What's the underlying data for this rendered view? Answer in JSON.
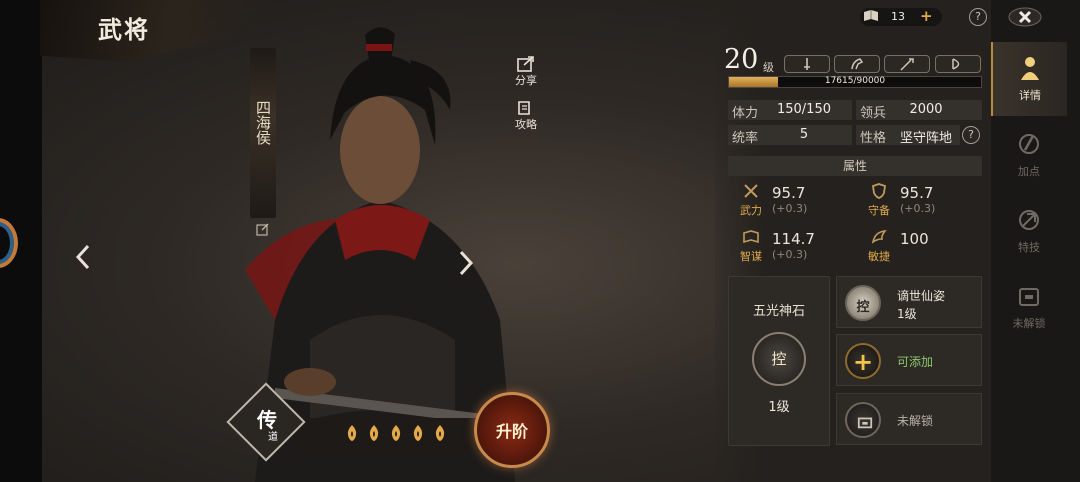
{
  "page_title": "武将",
  "hero": {
    "title_banner": "四海侯",
    "share_label": "分享",
    "guide_label": "攻略"
  },
  "bottom": {
    "chuandao_main": "传",
    "chuandao_sub": "道",
    "star_count": 5,
    "upgrade_label": "升阶"
  },
  "currency": {
    "value": "13",
    "plus": "+"
  },
  "help_glyph": "?",
  "level": {
    "value": "20",
    "unit": "级",
    "exp_text": "17615/90000",
    "exp_fraction": 0.1957
  },
  "stats": {
    "stamina_label": "体力",
    "stamina_value": "150/150",
    "troops_label": "领兵",
    "troops_value": "2000",
    "command_label": "统率",
    "command_value": "5",
    "nature_label": "性格",
    "nature_value": "坚守阵地"
  },
  "attributes": {
    "header": "属性",
    "items": [
      {
        "name": "武力",
        "value": "95.7",
        "bonus": "(+0.3)"
      },
      {
        "name": "守备",
        "value": "95.7",
        "bonus": "(+0.3)"
      },
      {
        "name": "智谋",
        "value": "114.7",
        "bonus": "(+0.3)"
      },
      {
        "name": "敏捷",
        "value": "100",
        "bonus": ""
      }
    ]
  },
  "stone": {
    "title": "五光神石",
    "char": "控",
    "level": "1级"
  },
  "skills": [
    {
      "name": "谪世仙姿",
      "level": "1级",
      "char": "控"
    },
    {
      "status": "可添加"
    },
    {
      "status": "未解锁"
    }
  ],
  "tabs": [
    {
      "label": "详情",
      "active": true
    },
    {
      "label": "加点",
      "active": false
    },
    {
      "label": "特技",
      "active": false
    },
    {
      "label": "未解锁",
      "active": false
    }
  ],
  "colors": {
    "accent_gold": "#e0a94a",
    "green": "#8cc76a",
    "exp_fill": "#e3b15a"
  }
}
